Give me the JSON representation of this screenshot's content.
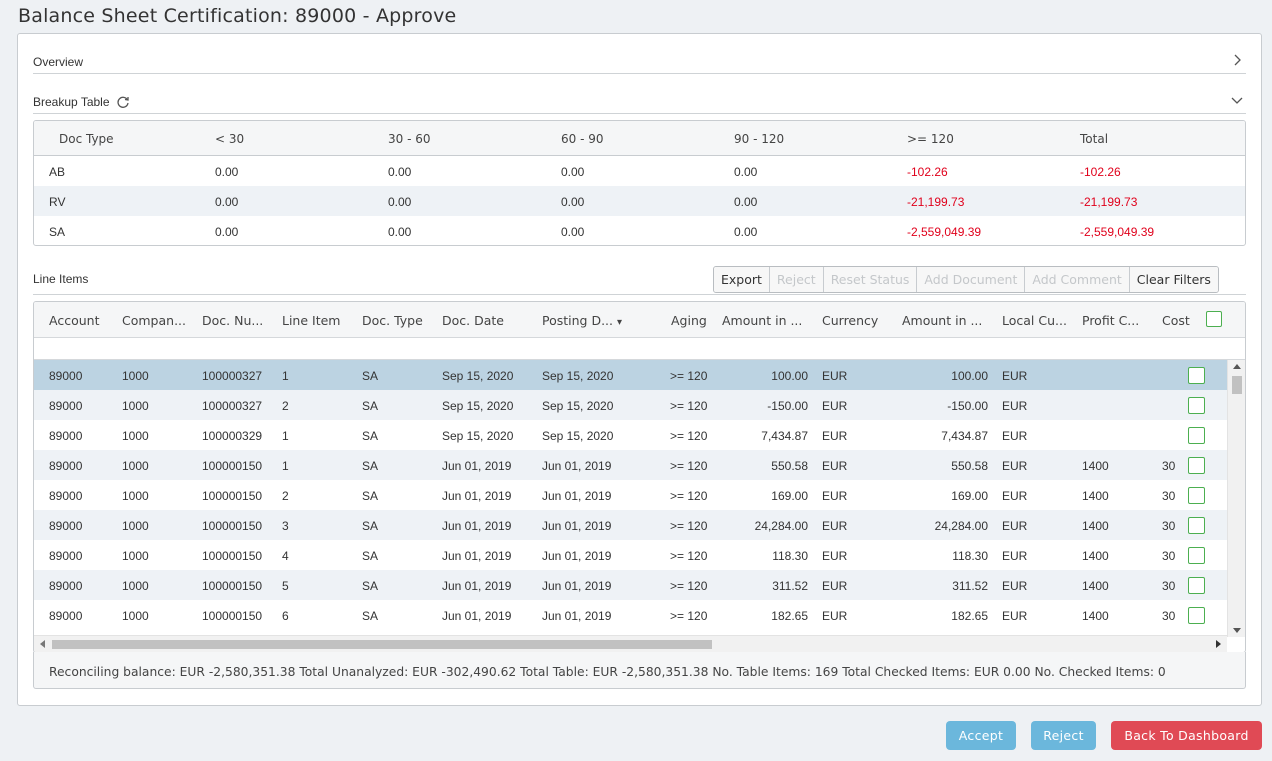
{
  "page": {
    "title": "Balance Sheet Certification: 89000 - Approve"
  },
  "overview": {
    "label": "Overview"
  },
  "breakup": {
    "label": "Breakup Table",
    "headers": [
      "Doc Type",
      "< 30",
      "30 - 60",
      "60 - 90",
      "90 - 120",
      ">= 120",
      "Total"
    ],
    "rows": [
      [
        "AB",
        "0.00",
        "0.00",
        "0.00",
        "0.00",
        "-102.26",
        "-102.26"
      ],
      [
        "RV",
        "0.00",
        "0.00",
        "0.00",
        "0.00",
        "-21,199.73",
        "-21,199.73"
      ],
      [
        "SA",
        "0.00",
        "0.00",
        "0.00",
        "0.00",
        "-2,559,049.39",
        "-2,559,049.39"
      ]
    ]
  },
  "line_items": {
    "label": "Line Items",
    "toolbar": {
      "export": "Export",
      "reject": "Reject",
      "reset_status": "Reset Status",
      "add_document": "Add Document",
      "add_comment": "Add Comment",
      "clear_filters": "Clear Filters"
    },
    "headers": [
      "Account",
      "Compan...",
      "Doc. Nu...",
      "Line Item",
      "Doc. Type",
      "Doc. Date",
      "Posting D...",
      "Aging",
      "Amount in ...",
      "Currency",
      "Amount in ...",
      "Local Cu...",
      "Profit C...",
      "Cost"
    ],
    "sort_indicator": "▾",
    "rows": [
      [
        "89000",
        "1000",
        "100000327",
        "1",
        "SA",
        "Sep 15, 2020",
        "Sep 15, 2020",
        ">= 120",
        "100.00",
        "EUR",
        "100.00",
        "EUR",
        "",
        ""
      ],
      [
        "89000",
        "1000",
        "100000327",
        "2",
        "SA",
        "Sep 15, 2020",
        "Sep 15, 2020",
        ">= 120",
        "-150.00",
        "EUR",
        "-150.00",
        "EUR",
        "",
        ""
      ],
      [
        "89000",
        "1000",
        "100000329",
        "1",
        "SA",
        "Sep 15, 2020",
        "Sep 15, 2020",
        ">= 120",
        "7,434.87",
        "EUR",
        "7,434.87",
        "EUR",
        "",
        ""
      ],
      [
        "89000",
        "1000",
        "100000150",
        "1",
        "SA",
        "Jun 01, 2019",
        "Jun 01, 2019",
        ">= 120",
        "550.58",
        "EUR",
        "550.58",
        "EUR",
        "1400",
        "30"
      ],
      [
        "89000",
        "1000",
        "100000150",
        "2",
        "SA",
        "Jun 01, 2019",
        "Jun 01, 2019",
        ">= 120",
        "169.00",
        "EUR",
        "169.00",
        "EUR",
        "1400",
        "30"
      ],
      [
        "89000",
        "1000",
        "100000150",
        "3",
        "SA",
        "Jun 01, 2019",
        "Jun 01, 2019",
        ">= 120",
        "24,284.00",
        "EUR",
        "24,284.00",
        "EUR",
        "1400",
        "30"
      ],
      [
        "89000",
        "1000",
        "100000150",
        "4",
        "SA",
        "Jun 01, 2019",
        "Jun 01, 2019",
        ">= 120",
        "118.30",
        "EUR",
        "118.30",
        "EUR",
        "1400",
        "30"
      ],
      [
        "89000",
        "1000",
        "100000150",
        "5",
        "SA",
        "Jun 01, 2019",
        "Jun 01, 2019",
        ">= 120",
        "311.52",
        "EUR",
        "311.52",
        "EUR",
        "1400",
        "30"
      ],
      [
        "89000",
        "1000",
        "100000150",
        "6",
        "SA",
        "Jun 01, 2019",
        "Jun 01, 2019",
        ">= 120",
        "182.65",
        "EUR",
        "182.65",
        "EUR",
        "1400",
        "30"
      ]
    ],
    "summary": "Reconciling balance:  EUR -2,580,351.38 Total Unanalyzed:  EUR -302,490.62 Total Table:  EUR -2,580,351.38 No. Table Items:  169 Total Checked Items:  EUR 0.00 No. Checked Items:  0"
  },
  "actions": {
    "accept": "Accept",
    "reject": "Reject",
    "back": "Back To Dashboard"
  },
  "colors": {
    "negative": "#e0001b",
    "selected_row": "#bcd3e2",
    "accent_blue": "#6bb7dc",
    "danger": "#e04a55",
    "checkbox": "#4caf50"
  }
}
